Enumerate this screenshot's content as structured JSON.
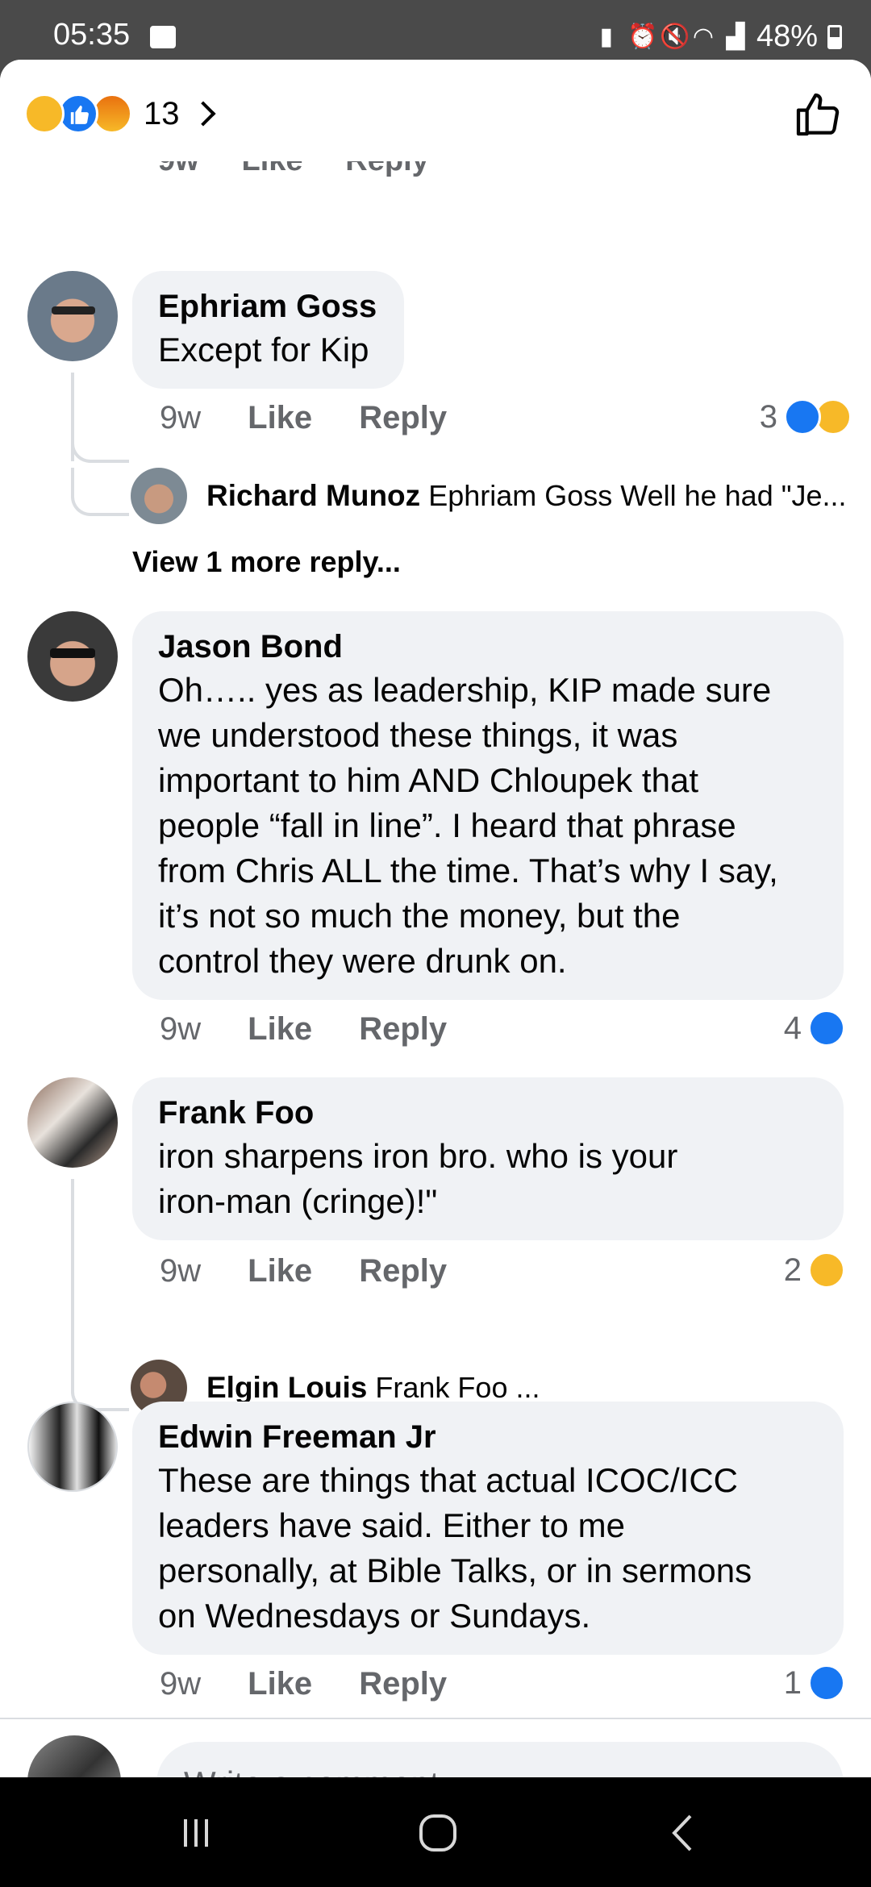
{
  "status_bar": {
    "time": "05:35",
    "battery": "48%"
  },
  "header": {
    "reaction_count": "13"
  },
  "comments": [
    {
      "author": "Ephriam Goss",
      "text": "Except for Kip",
      "time": "9w",
      "like": "Like",
      "reply": "Reply",
      "reaction_count": "3"
    },
    {
      "author": "Jason Bond",
      "lines": [
        "Oh….. yes as leadership, KIP made sure",
        "we understood these things, it was",
        "important to him AND Chloupek that",
        "people “fall in line”. I heard that phrase",
        "from Chris ALL the time. That’s why I say,",
        "it’s not so much the money, but the",
        "control they were drunk on."
      ],
      "time": "9w",
      "like": "Like",
      "reply": "Reply",
      "reaction_count": "4"
    },
    {
      "author": "Frank Foo",
      "lines": [
        "iron sharpens iron bro. who is your",
        "iron-man (cringe)!\""
      ],
      "time": "9w",
      "like": "Like",
      "reply": "Reply",
      "reaction_count": "2"
    },
    {
      "author": "Edwin Freeman Jr",
      "lines": [
        "These are things that actual ICOC/ICC",
        "leaders have said. Either to me",
        "personally, at Bible Talks, or in sermons",
        "on Wednesdays or Sundays."
      ],
      "time": "9w",
      "like": "Like",
      "reply": "Reply",
      "reaction_count": "1"
    }
  ],
  "replies": [
    {
      "author": "Richard Munoz",
      "preview": "Ephriam Goss Well he had \"Je..."
    },
    {
      "author": "Elgin Louis",
      "preview": "Frank Foo ..."
    }
  ],
  "view_more_replies": "View 1 more reply...",
  "composer": {
    "placeholder": "Write a comment..."
  },
  "colors": {
    "like_blue": "#1877f2",
    "bubble_bg": "#f0f2f5",
    "meta_gray": "#65676b",
    "haha_yellow": "#f7b928"
  }
}
